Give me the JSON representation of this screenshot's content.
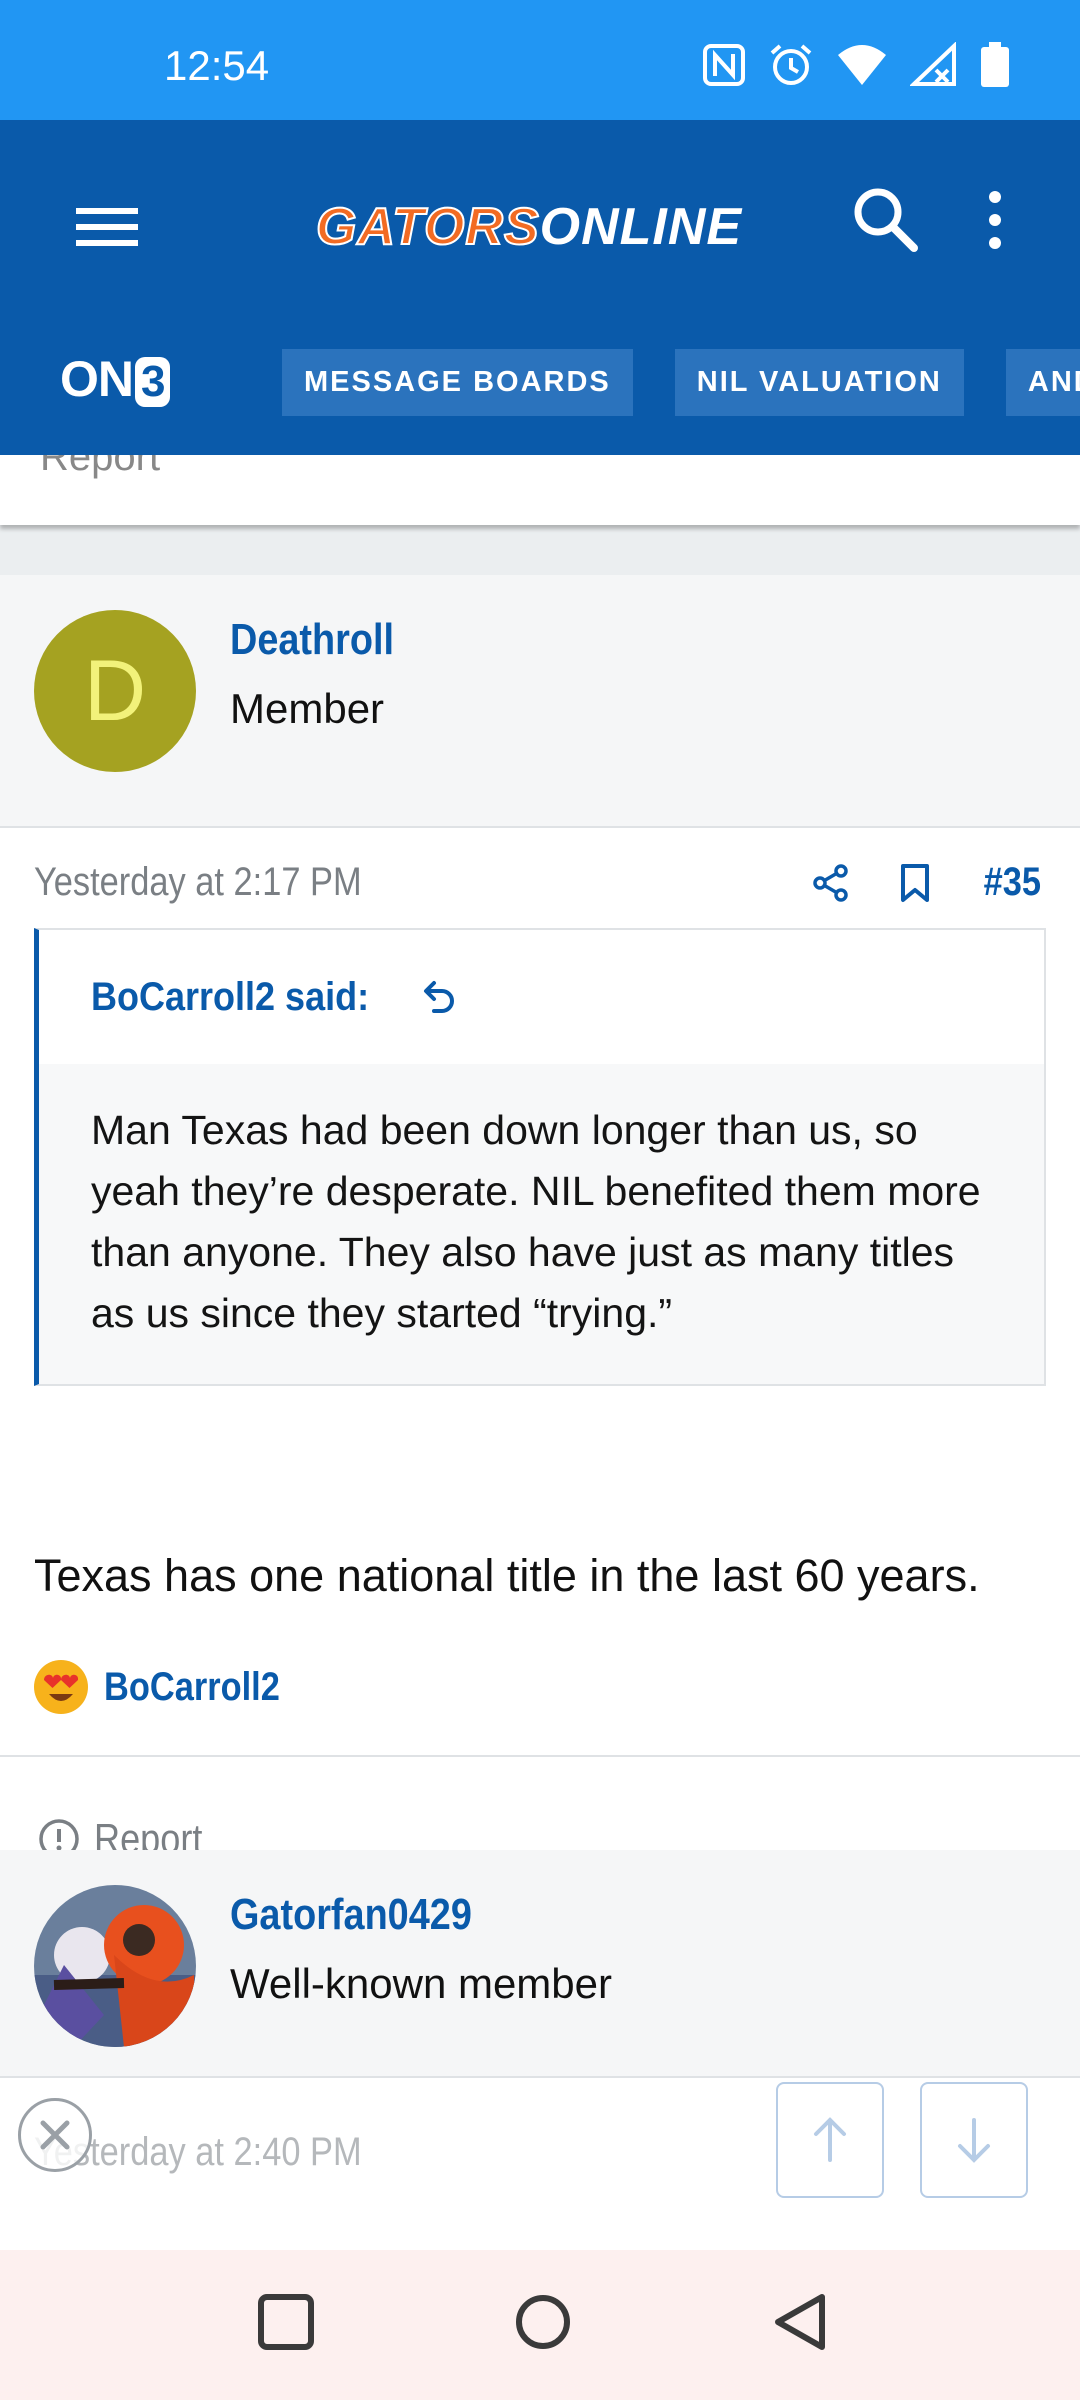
{
  "status_bar": {
    "time": "12:54",
    "icons": [
      "nfc-icon",
      "alarm-icon",
      "wifi-icon",
      "signal-icon",
      "battery-icon"
    ]
  },
  "header": {
    "logo_part1": "GATORS",
    "logo_part2": "ONLINE",
    "network_logo_prefix": "ON",
    "network_logo_suffix": "3",
    "nav_tabs": [
      "MESSAGE BOARDS",
      "NIL VALUATION",
      "ANDY"
    ]
  },
  "previous_post": {
    "report_label": "Report"
  },
  "post": {
    "author": "Deathroll",
    "author_initial": "D",
    "author_title": "Member",
    "timestamp": "Yesterday at 2:17 PM",
    "post_number": "#35",
    "quote": {
      "author_label": "BoCarroll2 said:",
      "text": "Man Texas had been down longer than us, so yeah they’re desperate. NIL benefited them more than anyone. They also have just as many titles as us since they started “trying.”"
    },
    "body": "Texas has one national title in the last 60 years.",
    "reaction_user": "BoCarroll2",
    "report_label": "Report"
  },
  "next_post": {
    "author": "Gatorfan0429",
    "author_title": "Well-known member",
    "timestamp": "Yesterday at 2:40 PM"
  },
  "colors": {
    "status_bar": "#2196f3",
    "header": "#0a5aaa",
    "accent": "#0a5aaa",
    "logo_orange": "#f26b23"
  }
}
